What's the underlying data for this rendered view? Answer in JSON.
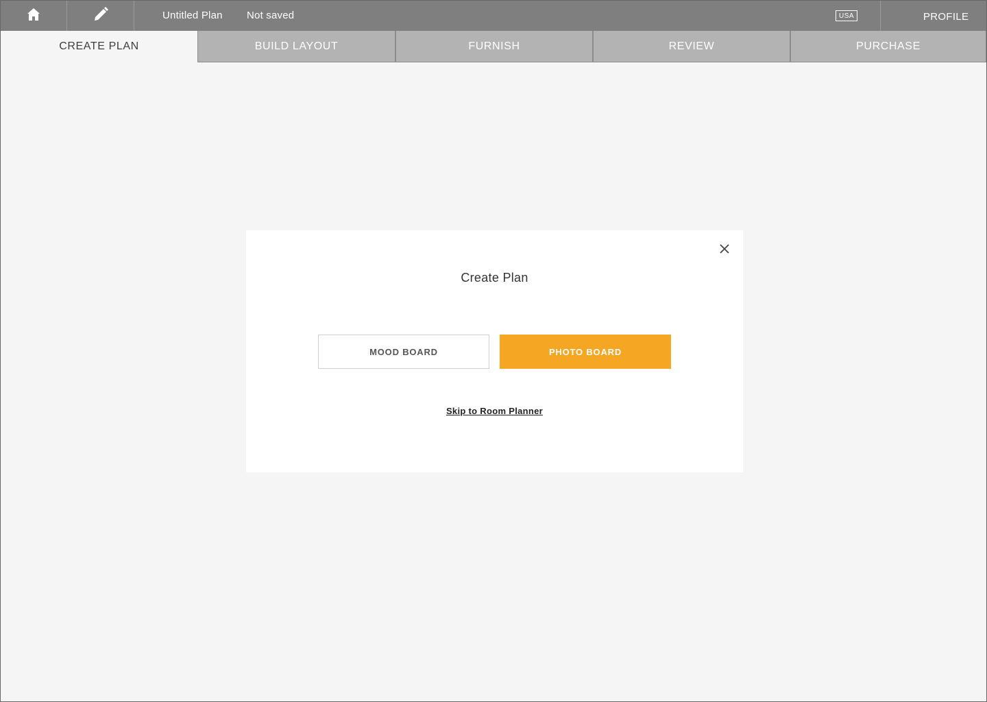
{
  "topbar": {
    "home_icon": "home-icon",
    "edit_icon": "pencil-icon",
    "plan_name": "Untitled Plan",
    "save_status": "Not saved",
    "region": "USA",
    "profile_label": "PROFILE",
    "background_color": "#7f7f7f"
  },
  "tabs": [
    {
      "label": "CREATE PLAN",
      "active": true
    },
    {
      "label": "BUILD LAYOUT",
      "active": false
    },
    {
      "label": "FURNISH",
      "active": false
    },
    {
      "label": "REVIEW",
      "active": false
    },
    {
      "label": "PURCHASE",
      "active": false
    }
  ],
  "modal": {
    "title": "Create Plan",
    "close_icon": "close-icon",
    "mood_board_label": "MOOD BOARD",
    "photo_board_label": "PHOTO BOARD",
    "skip_label": "Skip to Room Planner",
    "accent_color": "#f5a623"
  }
}
